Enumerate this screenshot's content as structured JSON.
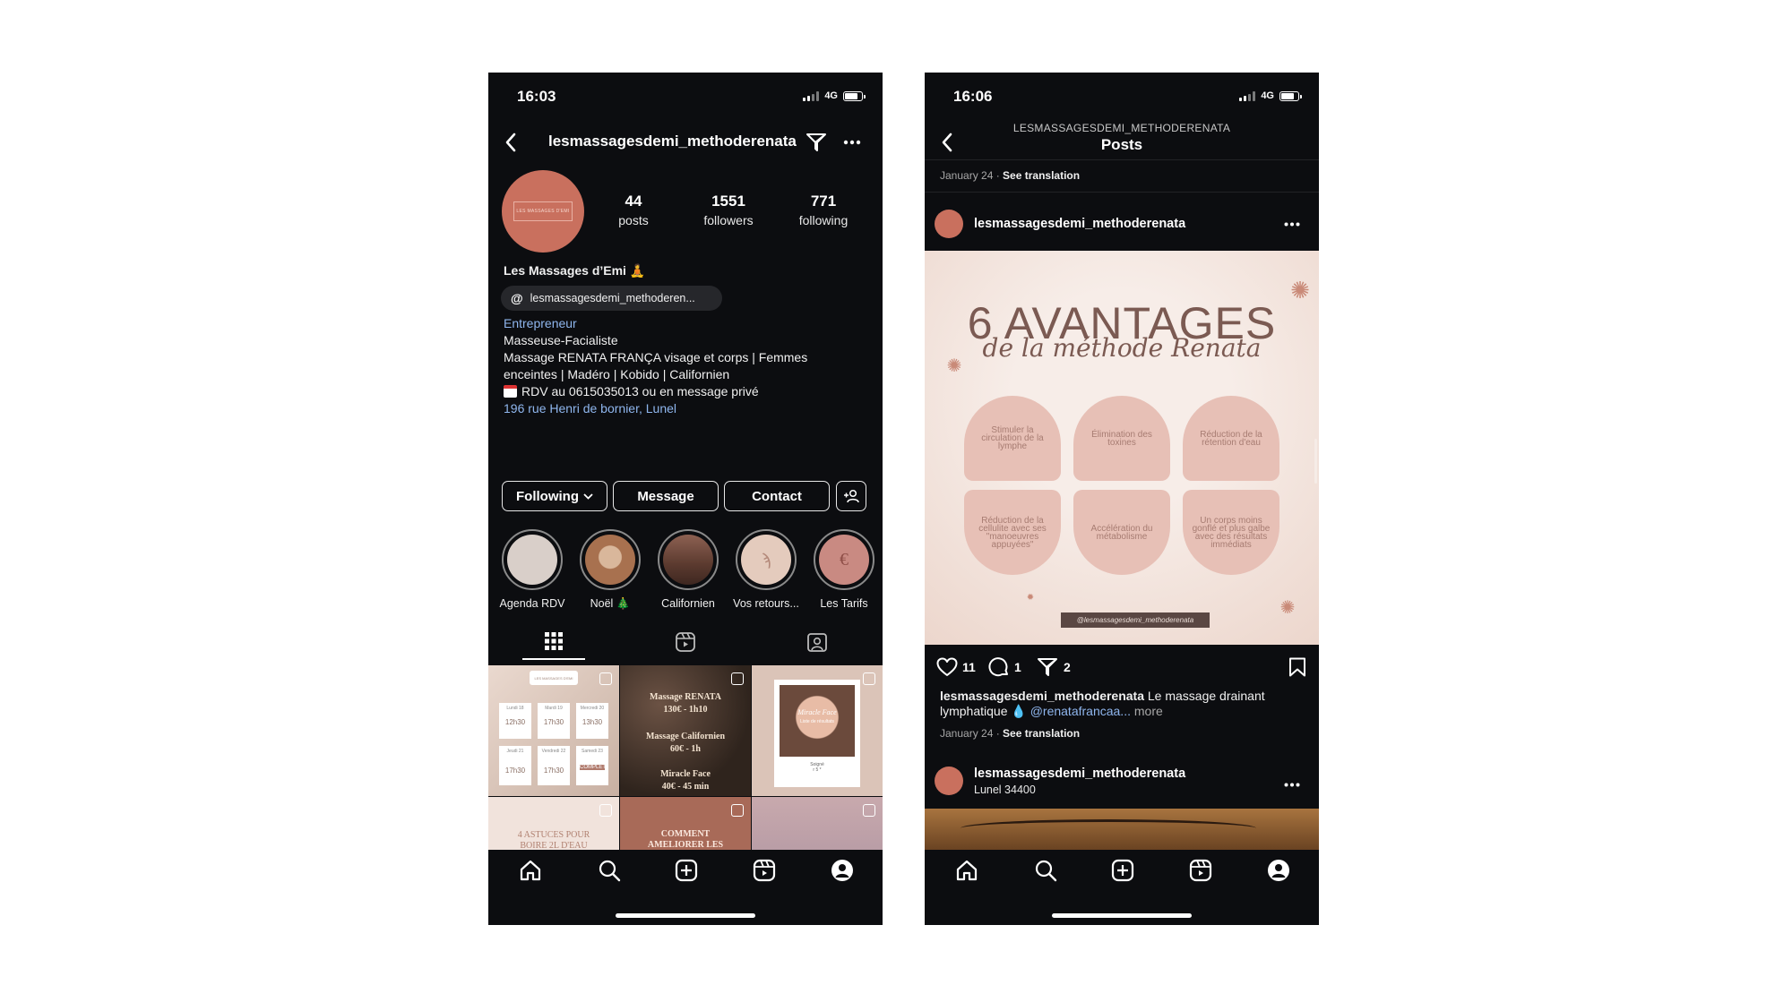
{
  "colors": {
    "background": "#0c0d10",
    "link_blue": "#8fb6ee",
    "avatar": "#c9705e",
    "post_bg": "#f3e6e0",
    "arch": "#e7c0b6",
    "title_brown": "#7b5a52"
  },
  "left": {
    "status": {
      "time": "16:03",
      "network": "4G"
    },
    "header": {
      "username": "lesmassagesdemi_methoderenata",
      "icons": [
        "back-icon",
        "filter-icon",
        "more-icon"
      ]
    },
    "avatar_text": "LES MASSAGES D'EMI",
    "stats": [
      {
        "value": "44",
        "label": "posts"
      },
      {
        "value": "1551",
        "label": "followers"
      },
      {
        "value": "771",
        "label": "following"
      }
    ],
    "profile": {
      "name": "Les Massages d’Emi",
      "threads_handle": "lesmassagesdemi_methoderen...",
      "category": "Entrepreneur",
      "bio": [
        "Masseuse-Facialiste",
        "Massage RENATA FRANÇA visage et corps | Femmes",
        "enceintes | Madéro | Kobido | Californien",
        "RDV au 0615035013 ou en message privé"
      ],
      "address": "196 rue Henri de bornier, Lunel"
    },
    "buttons": {
      "following": "Following",
      "message": "Message",
      "contact": "Contact"
    },
    "highlights": [
      {
        "label": "Agenda RDV",
        "color": "#d9cfc9"
      },
      {
        "label": "Noël 🎄",
        "color": "#a8714f"
      },
      {
        "label": "Californien",
        "color": "#6a4538"
      },
      {
        "label": "Vos retours...",
        "color": "#e4cbbd"
      },
      {
        "label": "Les Tarifs",
        "color": "#c98a82"
      }
    ],
    "grid": {
      "tile1": {
        "header": "LES MASSAGES D'EMI",
        "cells": [
          {
            "day": "Lundi 18",
            "time": "12h30"
          },
          {
            "day": "Mardi 19",
            "time": "17h30"
          },
          {
            "day": "Mercredi 20",
            "time": "13h30"
          },
          {
            "day": "Jeudi 21",
            "time": "17h30"
          },
          {
            "day": "Vendredi 22",
            "time": "17h30"
          },
          {
            "day": "Samedi 23",
            "time": "COMPLET"
          }
        ]
      },
      "tile2": [
        "Massage RENATA",
        "130€ - 1h10",
        "Massage Californien",
        "60€ - 1h",
        "Miracle Face",
        "40€ - 45 min"
      ],
      "tile3": {
        "title": "Miracle Face",
        "sub": "Liste de résultats",
        "before": "Soigné",
        "after": "r 5 *"
      },
      "tile4": "4 ASTUCES POUR BOIRE 2L D'EAU",
      "tile5": "COMMENT AMELIORER LES"
    }
  },
  "right": {
    "status": {
      "time": "16:06",
      "network": "4G"
    },
    "header": {
      "username": "LESMASSAGESDEMI_METHODERENATA",
      "title": "Posts"
    },
    "prev_meta": {
      "date": "January 24",
      "translate": "See translation"
    },
    "post": {
      "username": "lesmassagesdemi_methoderenata",
      "art": {
        "title": "6 AVANTAGES",
        "subtitle": "de la méthode Renata",
        "benefits_top": [
          "Stimuler la circulation de la lymphe",
          "Élimination des toxines",
          "Réduction de la rétention d'eau"
        ],
        "benefits_bottom": [
          "Réduction de la cellulite avec ses \"manoeuvres appuyées\"",
          "Accélération du métabolisme",
          "Un corps moins gonflé et plus galbe avec des résultats immédiats"
        ],
        "handle": "@lesmassagesdemi_methoderenata"
      },
      "likes": "11",
      "comments": "1",
      "shares": "2",
      "caption_user": "lesmassagesdemi_methoderenata",
      "caption_text": "Le massage drainant",
      "caption_text2": "lymphatique 💧",
      "caption_mention": "@renatafrancaa...",
      "caption_more": "more",
      "date": "January 24",
      "translate": "See translation"
    },
    "next_post": {
      "username": "lesmassagesdemi_methoderenata",
      "location": "Lunel 34400"
    }
  },
  "nav_icons": [
    "home-icon",
    "search-icon",
    "create-icon",
    "reels-icon",
    "profile-icon"
  ]
}
